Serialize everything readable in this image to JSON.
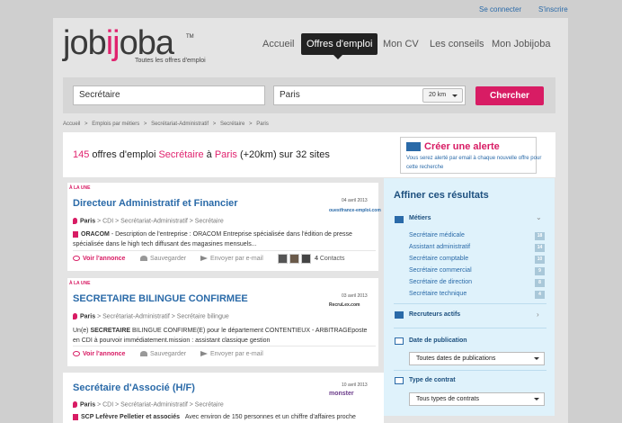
{
  "top_links": {
    "login": "Se connecter",
    "signup": "S'inscrire"
  },
  "logo": {
    "word_a": "job",
    "word_b": "ij",
    "word_c": "oba",
    "tm": "TM",
    "tagline": "Toutes les offres d'emploi"
  },
  "nav": {
    "items": [
      {
        "label": "Accueil"
      },
      {
        "label": "Offres d'emploi"
      },
      {
        "label": "Mon CV"
      },
      {
        "label": "Les conseils"
      },
      {
        "label": "Mon Jobijoba"
      }
    ]
  },
  "search": {
    "query": "Secrétaire",
    "location": "Paris",
    "radius": "20 km",
    "button": "Chercher"
  },
  "breadcrumb": [
    "Accueil",
    ">",
    "Emplois par métiers",
    ">",
    "Secrétariat-Administratif",
    ">",
    "Secrétaire",
    ">",
    "Paris"
  ],
  "results": {
    "count": "145",
    "t1": " offres d'emploi ",
    "job": "Secrétaire",
    "t2": " à ",
    "city": "Paris",
    "t3": " (+20km) sur 32 sites"
  },
  "alert": {
    "title": "Créer une alerte",
    "subtitle": "Vous serez alerté par email à chaque nouvelle offre pour cette recherche"
  },
  "jobs": [
    {
      "badge": "À LA UNE",
      "title": "Directeur Administratif et Financier",
      "date": "04 avril 2013",
      "source": "ouestfrance-emploi.com",
      "meta": {
        "city": "Paris",
        "rest": " > CDI > Secrétariat-Administratif > Secrétaire"
      },
      "company": "ORACOM",
      "desc": " - Description de l'entreprise : ORACOM Entreprise spécialisée dans l'édition de presse spécialisée dans le high tech diffusant des magasines mensuels...",
      "actions": {
        "view": "Voir l'annonce",
        "save": "Sauvegarder",
        "send": "Envoyer par e-mail",
        "contacts_n": "4",
        "contacts": "Contacts"
      }
    },
    {
      "badge": "À LA UNE",
      "title": "SECRETAIRE BILINGUE CONFIRMEE",
      "date": "03 avril 2013",
      "source": "RecruLex.com",
      "meta": {
        "city": "Paris",
        "rest": " > Secrétariat-Administratif > Secrétaire bilingue"
      },
      "desc_pre": "Un(e) ",
      "desc_bold": "SECRETAIRE",
      "desc": " BILINGUE CONFIRME(E) pour le département CONTENTIEUX - ARBITRAGEposte en CDI à pourvoir immédiatement.mission : assistant classique gestion",
      "actions": {
        "view": "Voir l'annonce",
        "save": "Sauvegarder",
        "send": "Envoyer par e-mail"
      }
    },
    {
      "title": "Secrétaire d'Associé (H/F)",
      "date": "10 avril 2013",
      "source": "monster",
      "meta": {
        "city": "Paris",
        "rest": " > CDI > Secrétariat-Administratif > Secrétaire"
      },
      "company": "SCP Lefèvre Pelletier et associés",
      "desc": "Avec environ de 150 personnes et un chiffre d'affaires proche"
    }
  ],
  "refine": {
    "title": "Affiner ces résultats",
    "metiers": {
      "title": "Métiers",
      "items": [
        {
          "label": "Secrétaire médicale",
          "count": "18"
        },
        {
          "label": "Assistant administratif",
          "count": "14"
        },
        {
          "label": "Secrétaire comptable",
          "count": "10"
        },
        {
          "label": "Secrétaire commercial",
          "count": "9"
        },
        {
          "label": "Secrétaire de direction",
          "count": "8"
        },
        {
          "label": "Secrétaire technique",
          "count": "4"
        }
      ]
    },
    "recruteurs": "Recruteurs actifs",
    "date": {
      "title": "Date de publication",
      "value": "Toutes dates de publications"
    },
    "contrat": {
      "title": "Type de contrat",
      "value": "Tous types de contrats"
    }
  },
  "colors": {
    "pink": "#d81c64",
    "blue": "#2a6aa8",
    "panel": "#dff2fb"
  }
}
